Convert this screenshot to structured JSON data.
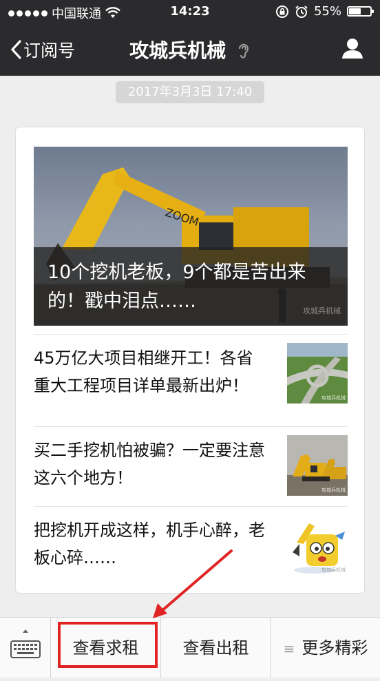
{
  "status_bar": {
    "carrier": "中国联通",
    "time": "14:23",
    "battery": "55%",
    "battery_level": 0.55
  },
  "nav": {
    "back_label": "订阅号",
    "title": "攻城兵机械"
  },
  "message_time": "2017年3月3日 17:40",
  "article_card": {
    "hero": {
      "caption": "10个挖机老板，9个都是苦出来的！戳中泪点……",
      "watermark": "攻城兵机械"
    },
    "items": [
      {
        "title": "45万亿大项目相继开工！各省重大工程项目详单最新出炉！",
        "thumb_watermark": "攻城兵机械"
      },
      {
        "title": "买二手挖机怕被骗？一定要注意这六个地方！",
        "thumb_watermark": "攻城兵机械"
      },
      {
        "title": "把挖机开成这样，机手心醉，老板心碎……",
        "thumb_watermark": "攻城兵机械"
      }
    ]
  },
  "bottom_menu": {
    "items": [
      {
        "label": "查看求租"
      },
      {
        "label": "查看出租"
      },
      {
        "label": "更多精彩"
      }
    ]
  },
  "colors": {
    "bar_bg": "#2b2b2e",
    "highlight": "#e02424"
  }
}
